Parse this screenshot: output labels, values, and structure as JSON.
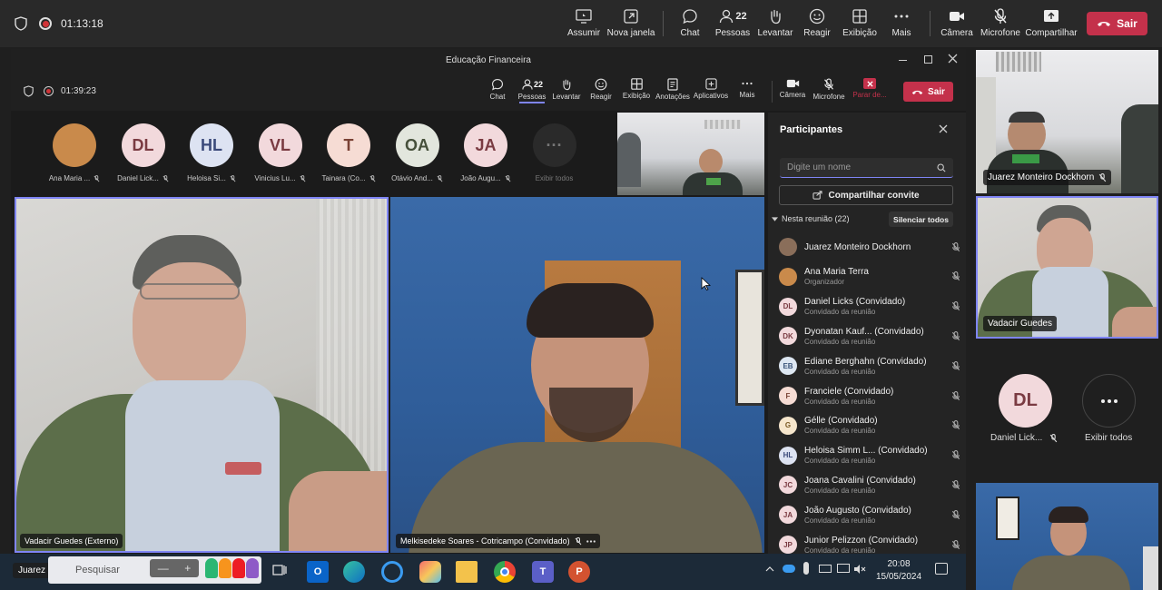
{
  "outer_bar": {
    "timer": "01:13:18",
    "buttons": {
      "assumir": "Assumir",
      "nova_janela": "Nova janela",
      "chat": "Chat",
      "pessoas": "Pessoas",
      "pessoas_count": "22",
      "levantar": "Levantar",
      "reagir": "Reagir",
      "exibicao": "Exibição",
      "mais": "Mais",
      "camera": "Câmera",
      "microfone": "Microfone",
      "compartilhar": "Compartilhar"
    },
    "leave": "Sair"
  },
  "inner_window": {
    "title": "Educação Financeira",
    "timer": "01:39:23",
    "buttons": {
      "chat": "Chat",
      "pessoas": "Pessoas",
      "pessoas_count": "22",
      "levantar": "Levantar",
      "reagir": "Reagir",
      "exibicao": "Exibição",
      "anotacoes": "Anotações",
      "aplicativos": "Aplicativos",
      "mais": "Mais",
      "camera": "Câmera",
      "microfone": "Microfone",
      "parar": "Parar de..."
    },
    "leave": "Sair"
  },
  "strip": [
    {
      "initials": "",
      "name": "Ana Maria ...",
      "bg": "#c98a4b"
    },
    {
      "initials": "DL",
      "name": "Daniel Lick...",
      "bg": "#f2d9dc",
      "fg": "#7a3b42"
    },
    {
      "initials": "HL",
      "name": "Heloisa Si...",
      "bg": "#dde3f2",
      "fg": "#3b4a7a"
    },
    {
      "initials": "VL",
      "name": "Vinicius Lu...",
      "bg": "#f2d9dc",
      "fg": "#7a3b42"
    },
    {
      "initials": "T",
      "name": "Tainara (Co...",
      "bg": "#f6dcd4",
      "fg": "#7a4235"
    },
    {
      "initials": "OA",
      "name": "Otávio And...",
      "bg": "#e2e6dd",
      "fg": "#46503b"
    },
    {
      "initials": "JA",
      "name": "João Augu...",
      "bg": "#f2d9dc",
      "fg": "#7a3b42"
    },
    {
      "initials": "···",
      "name": "Exibir todos",
      "bg": "#2a2a2a",
      "fg": "#777"
    }
  ],
  "videos": {
    "left_label": "Vadacir Guedes (Externo)",
    "right_label": "Melkisedeke Soares - Cotricampo (Convidado)"
  },
  "panel": {
    "title": "Participantes",
    "search_placeholder": "Digite um nome",
    "share_invite": "Compartilhar convite",
    "in_meeting": "Nesta reunião (22)",
    "mute_all": "Silenciar todos",
    "people": [
      {
        "initials": "",
        "name": "Juarez Monteiro Dockhorn",
        "sub": "",
        "bg": "#8a6e5a",
        "fg": "#fff"
      },
      {
        "initials": "",
        "name": "Ana Maria Terra",
        "sub": "Organizador",
        "bg": "#c98a4b",
        "fg": "#fff"
      },
      {
        "initials": "DL",
        "name": "Daniel Licks (Convidado)",
        "sub": "Convidado da reunião",
        "bg": "#f2d9dc",
        "fg": "#7a3b42"
      },
      {
        "initials": "DK",
        "name": "Dyonatan Kauf... (Convidado)",
        "sub": "Convidado da reunião",
        "bg": "#f2d9dc",
        "fg": "#7a3b42"
      },
      {
        "initials": "EB",
        "name": "Ediane Berghahn (Convidado)",
        "sub": "Convidado da reunião",
        "bg": "#dde7f2",
        "fg": "#3b557a"
      },
      {
        "initials": "F",
        "name": "Franciele (Convidado)",
        "sub": "Convidado da reunião",
        "bg": "#f6dcd4",
        "fg": "#7a4235"
      },
      {
        "initials": "G",
        "name": "Gélle (Convidado)",
        "sub": "Convidado da reunião",
        "bg": "#f6e6cc",
        "fg": "#7a5a25"
      },
      {
        "initials": "HL",
        "name": "Heloisa Simm L... (Convidado)",
        "sub": "Convidado da reunião",
        "bg": "#dde3f2",
        "fg": "#3b4a7a"
      },
      {
        "initials": "JC",
        "name": "Joana Cavalini (Convidado)",
        "sub": "Convidado da reunião",
        "bg": "#f2d9dc",
        "fg": "#7a3b42"
      },
      {
        "initials": "JA",
        "name": "João Augusto (Convidado)",
        "sub": "Convidado da reunião",
        "bg": "#f2d9dc",
        "fg": "#7a3b42"
      },
      {
        "initials": "JP",
        "name": "Junior Pelizzon (Convidado)",
        "sub": "Convidado da reunião",
        "bg": "#f2d9dc",
        "fg": "#7a3b42"
      }
    ]
  },
  "right_column": {
    "top_label": "Juarez Monteiro Dockhorn",
    "mid_label": "Vadacir Guedes",
    "dl_initials": "DL",
    "dl_name": "Daniel Lick...",
    "view_all": "Exibir todos"
  },
  "taskbar": {
    "user_label": "Juarez Monteiro Dockhorn",
    "search_text": "Pesquisar",
    "time": "20:08",
    "date": "15/05/2024"
  },
  "colors": {
    "leave_red": "#c4314b",
    "accent": "#7f85f5",
    "panel_bg": "#242424"
  }
}
